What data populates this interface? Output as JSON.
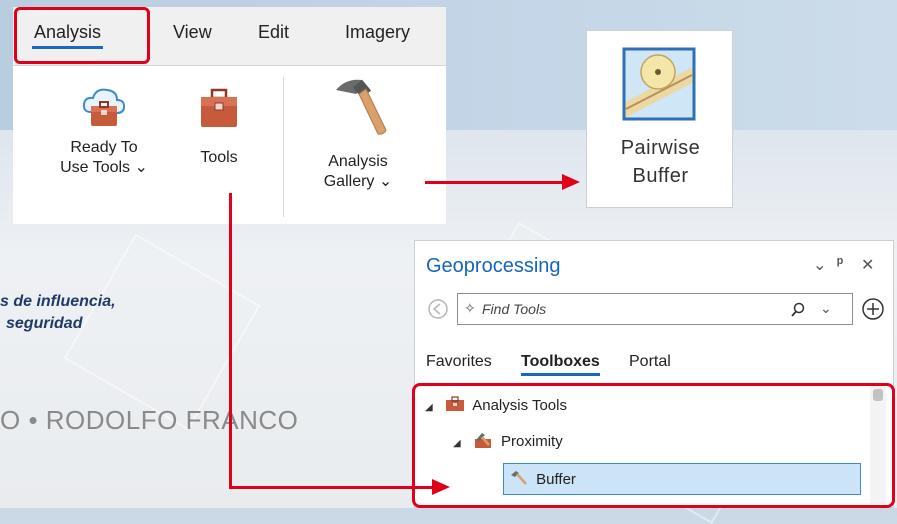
{
  "ribbon": {
    "tabs": [
      "Analysis",
      "View",
      "Edit",
      "Imagery"
    ],
    "buttons": {
      "ready_to_use": [
        "Ready To",
        "Use Tools ⌄"
      ],
      "tools": "Tools",
      "analysis_gallery": [
        "Analysis",
        "Gallery ⌄"
      ]
    }
  },
  "tile": {
    "label_line1": "Pairwise",
    "label_line2": "Buffer"
  },
  "slide": {
    "line1": "s de influencia,",
    "line2": "seguridad",
    "author": "O • RODOLFO FRANCO"
  },
  "geoprocessing": {
    "title": "Geoprocessing",
    "controls": {
      "dropdown": "⌄",
      "pin": "ᵖ",
      "close": "✕"
    },
    "search_placeholder": "Find Tools",
    "tabs": [
      "Favorites",
      "Toolboxes",
      "Portal"
    ],
    "active_tab": "Toolboxes",
    "tree": [
      {
        "label": "Analysis Tools",
        "level": 0
      },
      {
        "label": "Proximity",
        "level": 1
      },
      {
        "label": "Buffer",
        "level": 2,
        "selected": true
      }
    ]
  },
  "colors": {
    "highlight": "#e0001a",
    "accent": "#1769c4",
    "title_blue": "#1565c0"
  }
}
